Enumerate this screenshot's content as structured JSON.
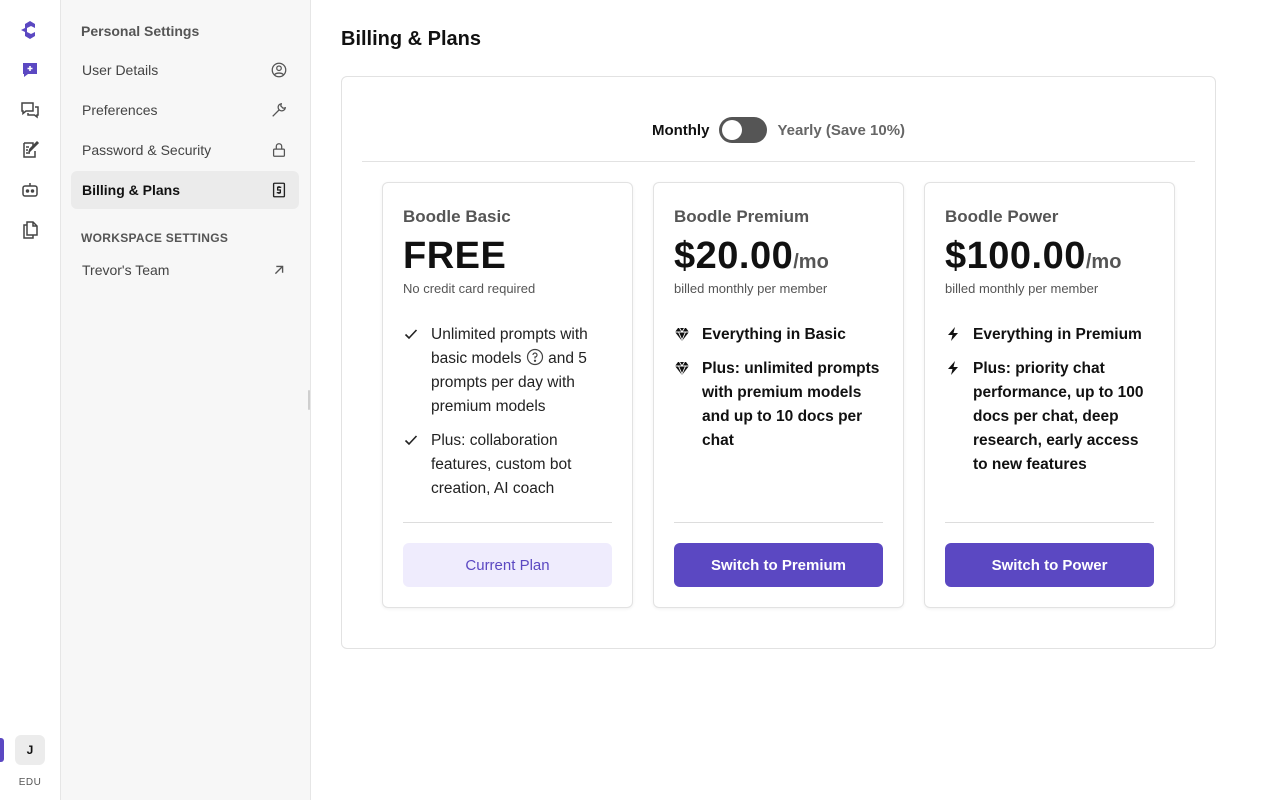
{
  "rail": {
    "icons": [
      "logo-icon",
      "new-chat-icon",
      "chats-icon",
      "prompts-icon",
      "bots-icon",
      "docs-icon"
    ],
    "avatar_initial": "J",
    "badge": "EDU"
  },
  "sidebar": {
    "personal_heading": "Personal Settings",
    "items": [
      {
        "label": "User Details",
        "icon": "user-circle-icon"
      },
      {
        "label": "Preferences",
        "icon": "wrench-icon"
      },
      {
        "label": "Password & Security",
        "icon": "lock-icon"
      },
      {
        "label": "Billing & Plans",
        "icon": "billing-icon",
        "active": true
      }
    ],
    "workspace_heading": "WORKSPACE SETTINGS",
    "workspace_items": [
      {
        "label": "Trevor's Team",
        "icon": "arrow-up-right-icon"
      }
    ]
  },
  "main": {
    "title": "Billing & Plans",
    "toggle": {
      "left_label": "Monthly",
      "right_label": "Yearly (Save 10%)",
      "yearly_on": false
    },
    "plans": [
      {
        "name": "Boodle Basic",
        "price": "FREE",
        "per": "",
        "subtitle": "No credit card required",
        "features": [
          {
            "pre": "Unlimited prompts with basic models",
            "post": "and 5 prompts per day with premium models",
            "icon": "check-icon"
          },
          {
            "text": "Plus: collaboration features, custom bot creation, AI coach",
            "icon": "check-icon"
          }
        ],
        "button": "Current Plan"
      },
      {
        "name": "Boodle Premium",
        "price": "$20.00",
        "per": "/mo",
        "subtitle": "billed monthly per member",
        "features": [
          {
            "text": "Everything in Basic",
            "icon": "gem-icon"
          },
          {
            "text": "Plus: unlimited prompts with premium models and up to 10 docs per chat",
            "icon": "gem-icon"
          }
        ],
        "button": "Switch to Premium"
      },
      {
        "name": "Boodle Power",
        "price": "$100.00",
        "per": "/mo",
        "subtitle": "billed monthly per member",
        "features": [
          {
            "text": "Everything in Premium",
            "icon": "bolt-icon"
          },
          {
            "text": "Plus: priority chat performance, up to 100 docs per chat, deep research, early access to new features",
            "icon": "bolt-icon"
          }
        ],
        "button": "Switch to Power"
      }
    ]
  },
  "colors": {
    "accent": "#5b48c2",
    "accent_light": "#efecfd",
    "sidebar_bg": "#f7f7f7"
  }
}
